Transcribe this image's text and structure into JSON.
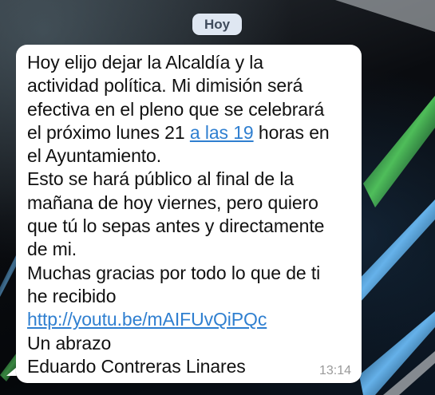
{
  "chat": {
    "date_pill": "Hoy",
    "message": {
      "lines": [
        "Hoy elijo dejar la Alcaldía y la",
        "actividad política. Mi dimisión será",
        "efectiva en el pleno que se celebrará"
      ],
      "line4_before": "el próximo lunes 21 ",
      "line4_link": "a las 19",
      "line4_after": " horas en",
      "lines_rest": [
        "el Ayuntamiento.",
        "Esto se hará público al final de la",
        "mañana de hoy viernes, pero quiero",
        "que tú lo sepas antes y directamente",
        "de mi.",
        "Muchas gracias por todo lo que de ti",
        "he recibido"
      ],
      "url_link": "http://youtu.be/mAIFUvQiPQc",
      "closing": [
        "Un abrazo",
        "Eduardo Contreras Linares"
      ],
      "time": "13:14"
    }
  },
  "colors": {
    "bubble": "#ffffff",
    "date_pill_bg": "#dfe7f2",
    "link": "#2f7fd0",
    "time": "#9a9a9a"
  }
}
